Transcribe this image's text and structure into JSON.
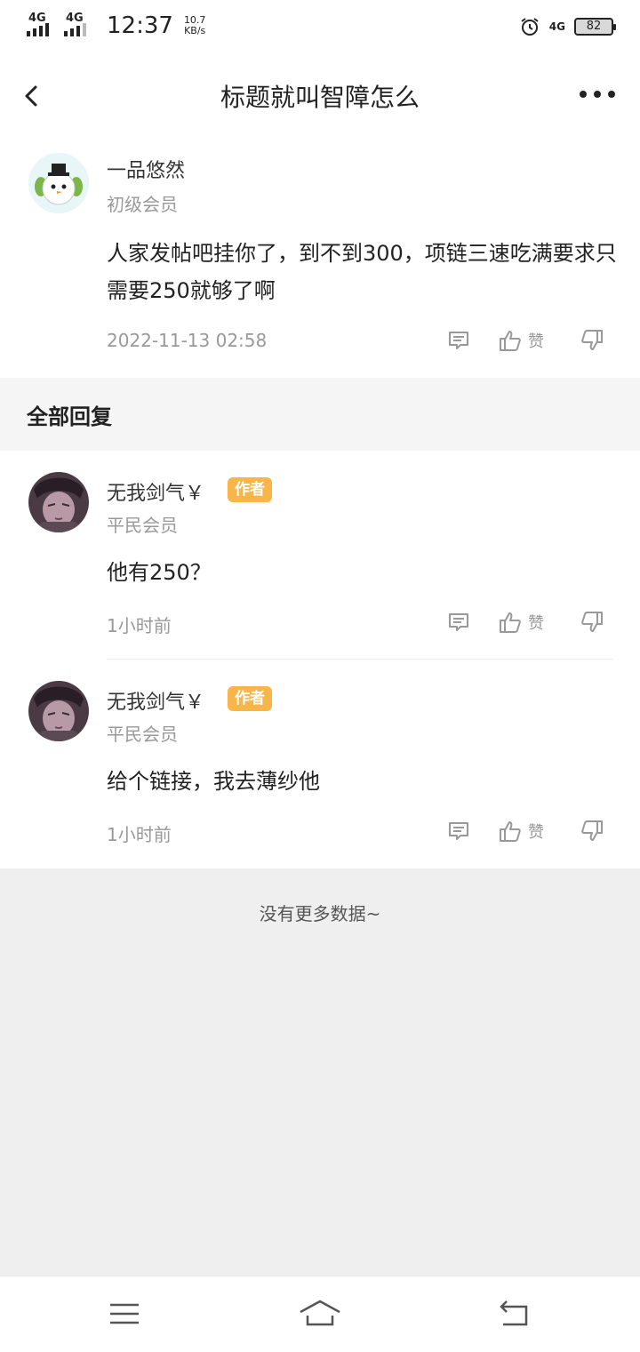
{
  "status": {
    "sim1": "4G",
    "sim2": "4G",
    "time": "12:37",
    "speed_value": "10.7",
    "speed_unit": "KB/s",
    "net": "4G",
    "battery": "82"
  },
  "header": {
    "title": "标题就叫智障怎么"
  },
  "post": {
    "username": "一品悠然",
    "level": "初级会员",
    "content": "人家发帖吧挂你了，到不到300，项链三速吃满要求只需要250就够了啊",
    "time": "2022-11-13 02:58",
    "like_label": "赞"
  },
  "replies_section": {
    "title": "全部回复"
  },
  "replies": [
    {
      "username": "无我剑气￥",
      "badge": "作者",
      "level": "平民会员",
      "content": "他有250？",
      "time": "1小时前",
      "like_label": "赞"
    },
    {
      "username": "无我剑气￥",
      "badge": "作者",
      "level": "平民会员",
      "content": "给个链接，我去薄纱他",
      "time": "1小时前",
      "like_label": "赞"
    }
  ],
  "footer": {
    "no_more": "没有更多数据~"
  },
  "colors": {
    "badge": "#f8b64a",
    "page_bg": "#efefef",
    "muted": "#999999"
  }
}
